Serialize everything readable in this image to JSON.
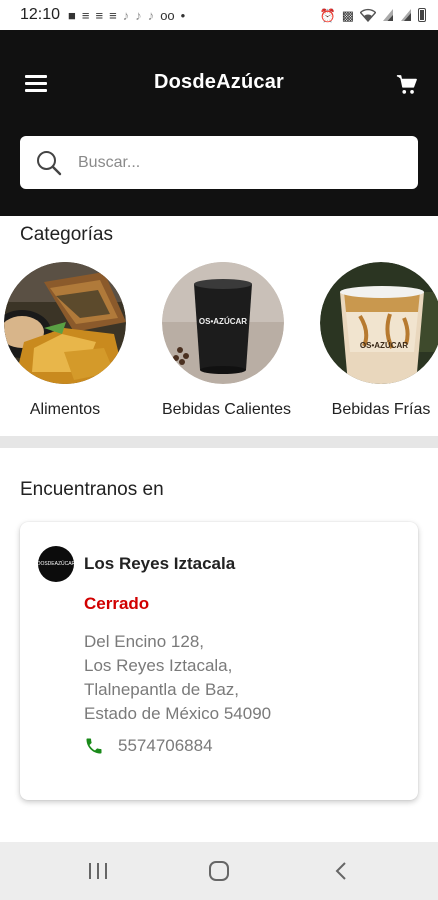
{
  "status_bar": {
    "time": "12:10",
    "left_icons": [
      "message-icon",
      "notification-icon",
      "notification-icon",
      "notification-icon",
      "tiktok-icon",
      "tiktok-icon",
      "tiktok-icon",
      "voicemail-icon",
      "dot-icon"
    ],
    "right_icons": [
      "alarm-icon",
      "lock-icon",
      "wifi-icon",
      "signal-icon",
      "signal-icon",
      "battery-icon"
    ]
  },
  "header": {
    "title": "DosdeAzúcar",
    "background": "#111111"
  },
  "search": {
    "placeholder": "Buscar..."
  },
  "categories": {
    "title": "Categorías",
    "items": [
      {
        "label": "Alimentos"
      },
      {
        "label": "Bebidas Calientes",
        "image_text": "OS•AZÚCAR"
      },
      {
        "label": "Bebidas Frías",
        "image_text": "OS•AZÚCAR"
      }
    ]
  },
  "locations": {
    "title": "Encuentranos en",
    "store": {
      "name": "Los Reyes Iztacala",
      "status": "Cerrado",
      "status_color": "#d10000",
      "address_lines": [
        "Del Encino 128,",
        "Los Reyes Iztacala,",
        "Tlalnepantla de Baz,",
        "Estado de México 54090"
      ],
      "phone": "5574706884",
      "phone_icon_color": "#1a8a1a"
    }
  },
  "nav_bar": {
    "buttons": [
      "recents-icon",
      "home-icon",
      "back-icon"
    ]
  }
}
